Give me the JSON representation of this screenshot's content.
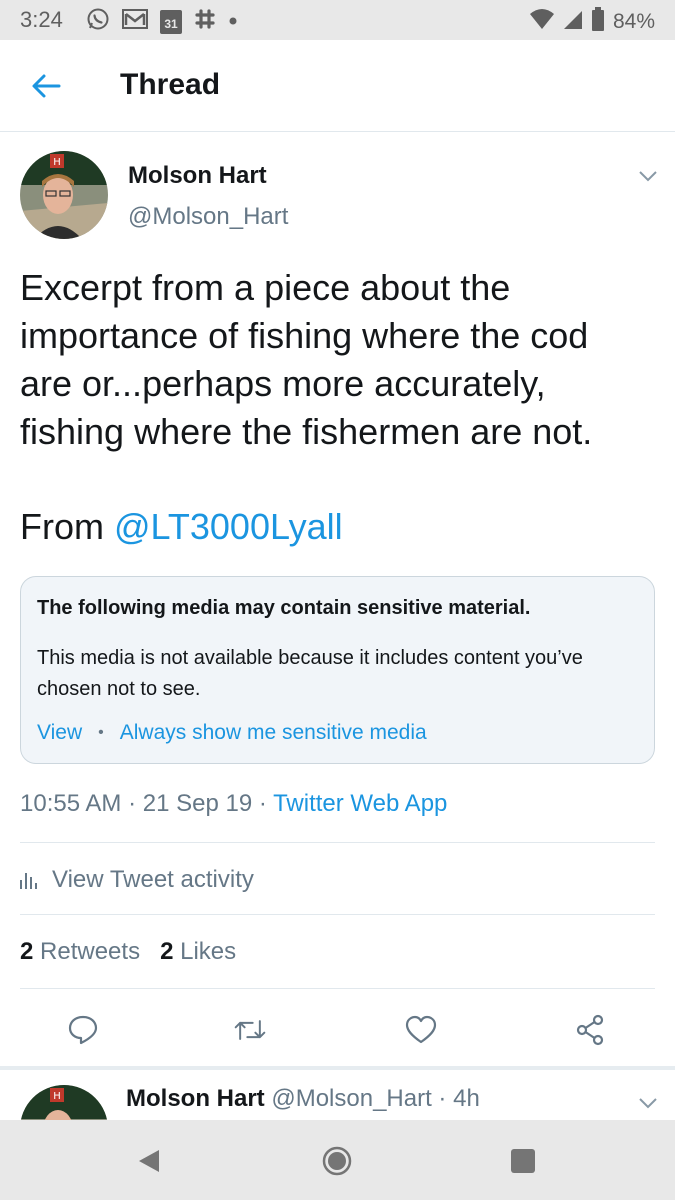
{
  "status_bar": {
    "time": "3:24",
    "calendar_day": "31",
    "battery": "84%",
    "icons_left": [
      "whatsapp-icon",
      "gmail-icon",
      "calendar-icon",
      "slack-icon",
      "dot-icon"
    ],
    "icons_right": [
      "wifi-icon",
      "signal-icon",
      "battery-icon"
    ]
  },
  "header": {
    "title": "Thread",
    "back_icon": "arrow-left-icon",
    "accent_color": "#1b95e0"
  },
  "tweet": {
    "author_name": "Molson Hart",
    "author_handle": "@Molson_Hart",
    "text_lines": [
      "Excerpt from a piece about the",
      "importance of fishing where the cod",
      "are or...perhaps more accurately,",
      "fishing where the fishermen are not."
    ],
    "from_prefix": "From ",
    "from_mention": "@LT3000Lyall",
    "sensitive": {
      "title": "The following media may contain sensitive material.",
      "body": "This media is not available because it includes content you’ve chosen not to see.",
      "view_label": "View",
      "separator": "•",
      "always_show_label": "Always show me sensitive media"
    },
    "time": "10:55 AM",
    "sep1": " · ",
    "date": "21 Sep 19",
    "sep2": " · ",
    "source": "Twitter Web App",
    "activity_label": "View Tweet activity",
    "retweets_count": "2",
    "retweets_label": "Retweets",
    "likes_count": "2",
    "likes_label": "Likes",
    "action_icons": [
      "reply-icon",
      "retweet-icon",
      "like-icon",
      "share-icon"
    ]
  },
  "next_tweet": {
    "author_name": "Molson Hart",
    "author_handle": "@Molson_Hart",
    "sep": " · ",
    "age": "4h"
  },
  "nav_bar": {
    "icons": [
      "back-triangle-icon",
      "home-circle-icon",
      "recents-square-icon"
    ]
  },
  "colors": {
    "text": "#14171a",
    "secondary_text": "#657786",
    "link": "#1b95e0",
    "divider": "#e1e8ed",
    "sensitive_bg": "#f1f5f9"
  }
}
